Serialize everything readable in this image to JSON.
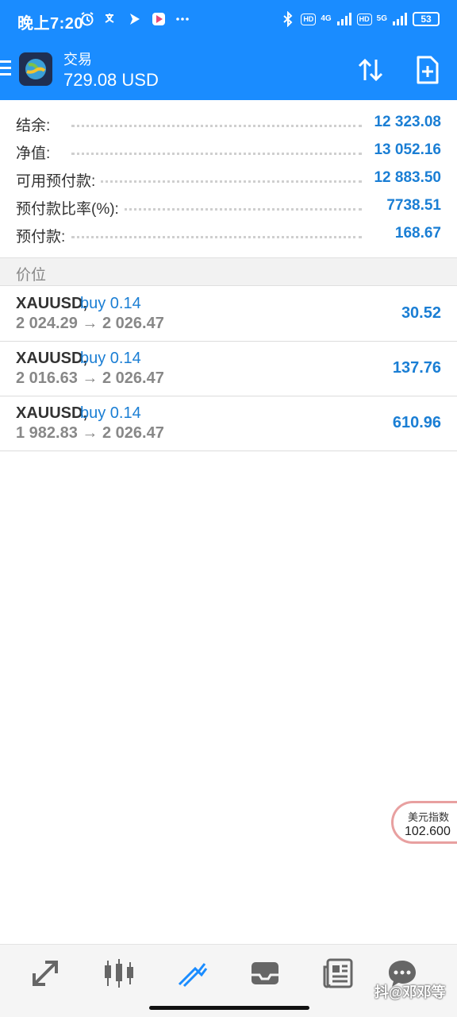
{
  "status_bar": {
    "time": "晚上7:20",
    "network_1": "4G",
    "network_2": "5G",
    "hd_1": "HD",
    "hd_2": "HD",
    "battery": "53"
  },
  "app_bar": {
    "title": "交易",
    "subtitle": "729.08 USD",
    "sort_icon": "sort-arrows-icon",
    "new_order_icon": "new-document-icon"
  },
  "summary": {
    "rows": [
      {
        "label": "结余:",
        "value": "12 323.08"
      },
      {
        "label": "净值:",
        "value": "13 052.16"
      },
      {
        "label": "可用预付款:",
        "value": "12 883.50"
      },
      {
        "label": "预付款比率(%):",
        "value": "7738.51"
      },
      {
        "label": "预付款:",
        "value": "168.67"
      }
    ]
  },
  "positions_header": "价位",
  "positions": [
    {
      "symbol": "XAUUSD,",
      "side": "buy 0.14",
      "prices": "2 024.29 → 2 026.47",
      "profit": "30.52"
    },
    {
      "symbol": "XAUUSD,",
      "side": "buy 0.14",
      "prices": "2 016.63 → 2 026.47",
      "profit": "137.76"
    },
    {
      "symbol": "XAUUSD,",
      "side": "buy 0.14",
      "prices": "1 982.83 → 2 026.47",
      "profit": "610.96"
    }
  ],
  "widget": {
    "label": "美元指数",
    "value": "102.600"
  },
  "bottom_nav": {
    "items": [
      "quotes-icon",
      "chart-icon",
      "trade-icon",
      "history-icon",
      "news-icon",
      "chat-icon"
    ],
    "active": "trade-icon"
  },
  "watermark": "抖@邓邓等",
  "colors": {
    "accent": "#1a8cff",
    "value_blue": "#1a7ed4"
  }
}
